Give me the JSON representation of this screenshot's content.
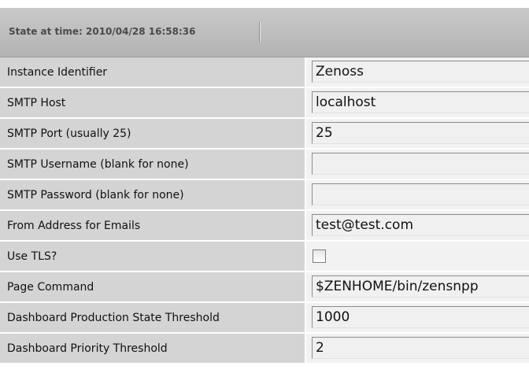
{
  "header": {
    "title": "State at time: 2010/04/28 16:58:36"
  },
  "form": {
    "rows": [
      {
        "label": "Instance Identifier",
        "type": "text",
        "value": "Zenoss"
      },
      {
        "label": "SMTP Host",
        "type": "text",
        "value": "localhost"
      },
      {
        "label": "SMTP Port (usually 25)",
        "type": "text",
        "value": "25"
      },
      {
        "label": "SMTP Username (blank for none)",
        "type": "text",
        "value": ""
      },
      {
        "label": "SMTP Password (blank for none)",
        "type": "text",
        "value": ""
      },
      {
        "label": "From Address for Emails",
        "type": "text",
        "value": "test@test.com"
      },
      {
        "label": "Use TLS?",
        "type": "checkbox",
        "checked": false
      },
      {
        "label": "Page Command",
        "type": "text",
        "value": "$ZENHOME/bin/zensnpp"
      },
      {
        "label": "Dashboard Production State Threshold",
        "type": "text",
        "value": "1000"
      },
      {
        "label": "Dashboard Priority Threshold",
        "type": "text",
        "value": "2"
      }
    ]
  },
  "colors": {
    "header_bg": "#bdbdbd",
    "label_bg": "#d4d4d4",
    "field_bg": "#f0f0f0"
  }
}
